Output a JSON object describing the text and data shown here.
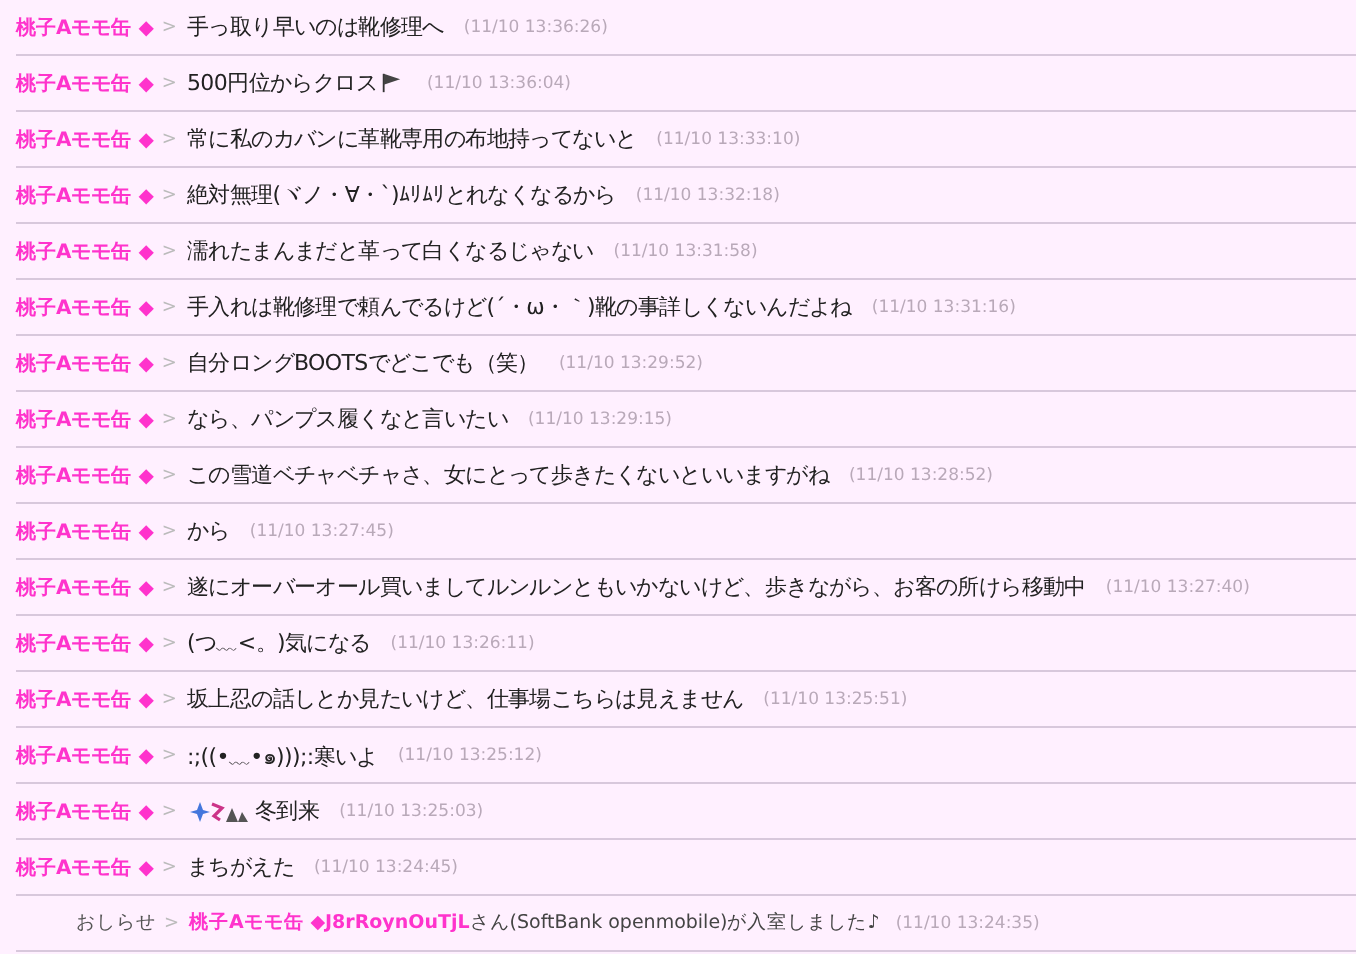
{
  "messages": [
    {
      "kind": "post",
      "name": "桃子Aモモ缶 ◆",
      "sep": ">",
      "text": "手っ取り早いのは靴修理へ",
      "time": "(11/10 13:36:26)"
    },
    {
      "kind": "post-icon-after",
      "name": "桃子Aモモ缶 ◆",
      "sep": ">",
      "text": "500円位からクロス",
      "time": "(11/10 13:36:04)"
    },
    {
      "kind": "post",
      "name": "桃子Aモモ缶 ◆",
      "sep": ">",
      "text": "常に私のカバンに革靴専用の布地持ってないと",
      "time": "(11/10 13:33:10)"
    },
    {
      "kind": "post",
      "name": "桃子Aモモ缶 ◆",
      "sep": ">",
      "text": "絶対無理(ヾノ・∀・`)ﾑﾘﾑﾘとれなくなるから",
      "time": "(11/10 13:32:18)"
    },
    {
      "kind": "post",
      "name": "桃子Aモモ缶 ◆",
      "sep": ">",
      "text": "濡れたまんまだと革って白くなるじゃない",
      "time": "(11/10 13:31:58)"
    },
    {
      "kind": "post",
      "name": "桃子Aモモ缶 ◆",
      "sep": ">",
      "text": "手入れは靴修理で頼んでるけど(´・ω・｀)靴の事詳しくないんだよね",
      "time": "(11/10 13:31:16)"
    },
    {
      "kind": "post",
      "name": "桃子Aモモ缶 ◆",
      "sep": ">",
      "text": "自分ロングBOOTSでどこでも（笑）",
      "time": "(11/10 13:29:52)"
    },
    {
      "kind": "post",
      "name": "桃子Aモモ缶 ◆",
      "sep": ">",
      "text": "なら、パンプス履くなと言いたい",
      "time": "(11/10 13:29:15)"
    },
    {
      "kind": "post",
      "name": "桃子Aモモ缶 ◆",
      "sep": ">",
      "text": "この雪道ベチャベチャさ、女にとって歩きたくないといいますがね",
      "time": "(11/10 13:28:52)"
    },
    {
      "kind": "post",
      "name": "桃子Aモモ缶 ◆",
      "sep": ">",
      "text": "から",
      "time": "(11/10 13:27:45)"
    },
    {
      "kind": "post",
      "name": "桃子Aモモ缶 ◆",
      "sep": ">",
      "text": "遂にオーバーオール買いましてルンルンともいかないけど、歩きながら、お客の所けら移動中",
      "time": "(11/10 13:27:40)"
    },
    {
      "kind": "post",
      "name": "桃子Aモモ缶 ◆",
      "sep": ">",
      "text": "(つ﹏<。)気になる",
      "time": "(11/10 13:26:11)"
    },
    {
      "kind": "post",
      "name": "桃子Aモモ缶 ◆",
      "sep": ">",
      "text": "坂上忍の話しとか見たいけど、仕事場こちらは見えません",
      "time": "(11/10 13:25:51)"
    },
    {
      "kind": "post",
      "name": "桃子Aモモ缶 ◆",
      "sep": ">",
      "text": ":;((•﹏•๑)));:寒いよ",
      "time": "(11/10 13:25:12)"
    },
    {
      "kind": "post-icon-before",
      "name": "桃子Aモモ缶 ◆",
      "sep": ">",
      "text": "冬到来",
      "time": "(11/10 13:25:03)"
    },
    {
      "kind": "post",
      "name": "桃子Aモモ缶 ◆",
      "sep": ">",
      "text": "まちがえた",
      "time": "(11/10 13:24:45)"
    },
    {
      "kind": "notice",
      "label": "おしらせ",
      "sep": ">",
      "name": "桃子Aモモ缶 ◆J8rRoynOuTjL",
      "text": "さん(SoftBank openmobile)が入室しました♪",
      "time": "(11/10 13:24:35)"
    }
  ]
}
